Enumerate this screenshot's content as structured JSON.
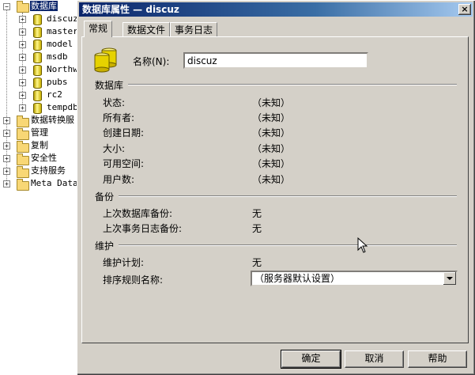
{
  "tree": {
    "root": "数据库",
    "databases": [
      "discuz",
      "master",
      "model",
      "msdb",
      "Northw",
      "pubs",
      "rc2",
      "tempdb"
    ],
    "others": [
      "数据转换服",
      "管理",
      "复制",
      "安全性",
      "支持服务",
      "Meta Data"
    ]
  },
  "dialog": {
    "title": "数据库属性 — discuz",
    "close_label": "×",
    "tabs": [
      "常规",
      "数据文件",
      "事务日志"
    ],
    "name_label": "名称(N):",
    "name_value": "discuz",
    "sections": {
      "database": {
        "title": "数据库",
        "rows": [
          {
            "label": "状态:",
            "value": "（未知）"
          },
          {
            "label": "所有者:",
            "value": "（未知）"
          },
          {
            "label": "创建日期:",
            "value": "（未知）"
          },
          {
            "label": "大小:",
            "value": "（未知）"
          },
          {
            "label": "可用空间:",
            "value": "（未知）"
          },
          {
            "label": "用户数:",
            "value": "（未知）"
          }
        ]
      },
      "backup": {
        "title": "备份",
        "rows": [
          {
            "label": "上次数据库备份:",
            "value": "无"
          },
          {
            "label": "上次事务日志备份:",
            "value": "无"
          }
        ]
      },
      "maintenance": {
        "title": "维护",
        "plan_label": "维护计划:",
        "plan_value": "无",
        "collation_label": "排序规则名称:",
        "collation_value": "（服务器默认设置）"
      }
    },
    "buttons": {
      "ok": "确定",
      "cancel": "取消",
      "help": "帮助"
    }
  },
  "colors": {
    "titlebar_start": "#0a246a",
    "titlebar_end": "#a6caf0",
    "face": "#d4d0c8",
    "selection": "#0a246a"
  }
}
